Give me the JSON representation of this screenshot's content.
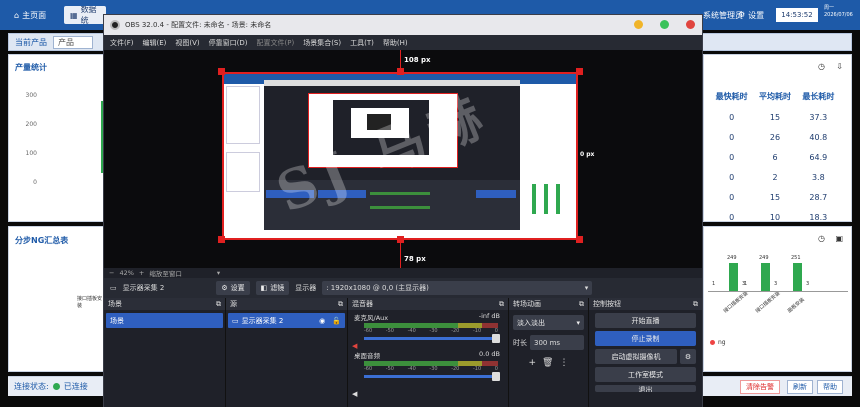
{
  "bg": {
    "tabs": [
      "主页面",
      "数据统"
    ],
    "sys_label": "系统管理员",
    "settings": "设置",
    "clock": "14:53:52",
    "date_line1": "周一",
    "date_line2": "2026/07/06",
    "current_product_label": "当前产品",
    "product_value": "产品",
    "output_title": "产量统计",
    "yticks": [
      "300",
      "200",
      "100",
      "0"
    ],
    "stats_headers": [
      "最快耗时",
      "平均耗时",
      "最长耗时"
    ],
    "stats_rows": [
      [
        "0",
        "15",
        "37.3"
      ],
      [
        "0",
        "26",
        "40.8"
      ],
      [
        "0",
        "6",
        "64.9"
      ],
      [
        "0",
        "2",
        "3.8"
      ],
      [
        "0",
        "15",
        "28.7"
      ],
      [
        "0",
        "10",
        "18.3"
      ]
    ],
    "ng_title": "分步NG汇总表",
    "ng_left_label": "接口插板安装",
    "ng_bars": [
      {
        "top": "249",
        "left": "1",
        "right": "3"
      },
      {
        "top": "249",
        "left": "1",
        "right": "3"
      },
      {
        "top": "251",
        "left": "",
        "right": "3"
      }
    ],
    "ng_xlabels": [
      "接口插板安装",
      "接口插板安装",
      "面板安装"
    ],
    "ng_legend": "ng",
    "conn_label": "连接状态:",
    "conn_value": "已连接",
    "btn_clear": "清除告警",
    "btn_refresh": "刷新",
    "btn_help": "帮助"
  },
  "obs": {
    "title": "OBS 32.0.4 - 配置文件: 未命名 - 场景: 未命名",
    "menu": [
      "文件(F)",
      "编辑(E)",
      "视图(V)",
      "停靠窗口(D)",
      "配置文件(P)",
      "场景集合(S)",
      "工具(T)",
      "帮助(H)"
    ],
    "top_px": "108 px",
    "bottom_px": "78 px",
    "right_px": "0 px",
    "zoom": "42%",
    "zoom_fit": "缩放至窗口",
    "source_name": "显示器采集 2",
    "btn_settings": "设置",
    "btn_filters": "滤镜",
    "display_label": "显示器",
    "display_value": ": 1920x1080 @ 0,0 (主显示器)",
    "scenes_title": "场景",
    "scene_item": "场景",
    "sources_title": "源",
    "source_item": "显示器采集 2",
    "mixer_title": "混音器",
    "mic_label": "麦克风/Aux",
    "mic_db": "-inf dB",
    "desktop_label": "桌面音频",
    "desktop_db": "0.0 dB",
    "meter_ticks": [
      "-60",
      "-55",
      "-50",
      "-45",
      "-40",
      "-35",
      "-30",
      "-25",
      "-20",
      "-15",
      "-10",
      "-5",
      "0"
    ],
    "transitions_title": "转场动画",
    "transition_value": "淡入淡出",
    "duration_label": "时长",
    "duration_value": "300 ms",
    "controls_title": "控制按钮",
    "ctrl_stream": "开始直播",
    "ctrl_record": "停止录制",
    "ctrl_vcam": "启动虚拟摄像机",
    "ctrl_studio": "工作室模式",
    "ctrl_exit": "退出"
  },
  "watermark": "SJ 马赫"
}
